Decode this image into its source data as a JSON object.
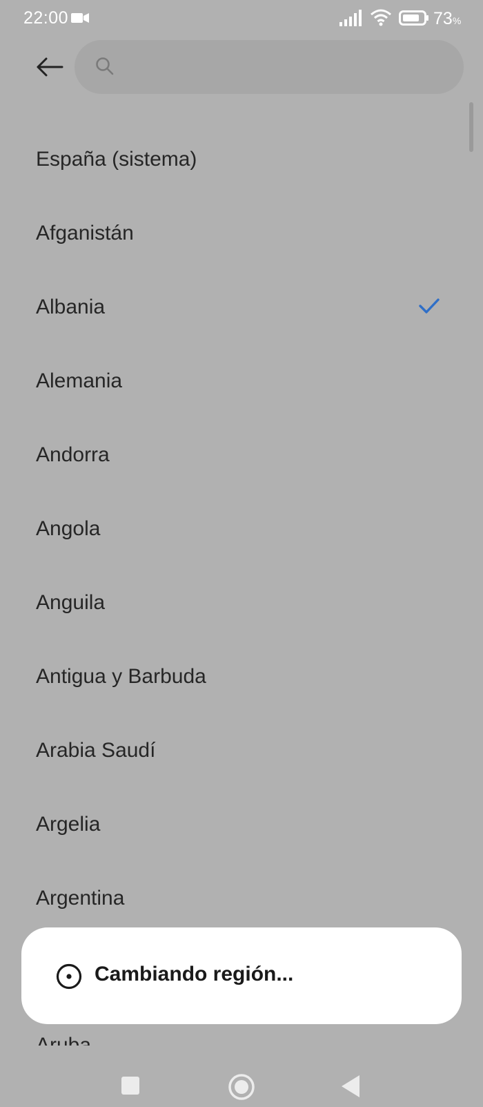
{
  "status_bar": {
    "time": "22:00",
    "battery_percent": "73",
    "battery_unit": "%",
    "icons": [
      "video-camera-icon",
      "signal-icon",
      "wifi-icon",
      "battery-icon"
    ]
  },
  "search": {
    "placeholder": "",
    "value": ""
  },
  "regions": [
    {
      "label": "España (sistema)",
      "selected": false
    },
    {
      "label": "Afganistán",
      "selected": false
    },
    {
      "label": "Albania",
      "selected": true
    },
    {
      "label": "Alemania",
      "selected": false
    },
    {
      "label": "Andorra",
      "selected": false
    },
    {
      "label": "Angola",
      "selected": false
    },
    {
      "label": "Anguila",
      "selected": false
    },
    {
      "label": "Antigua y Barbuda",
      "selected": false
    },
    {
      "label": "Arabia Saudí",
      "selected": false
    },
    {
      "label": "Argelia",
      "selected": false
    },
    {
      "label": "Argentina",
      "selected": false
    }
  ],
  "partial_item": "Aruba",
  "toast": {
    "message": "Cambiando región..."
  },
  "colors": {
    "background": "#b1b1b1",
    "accent_check": "#2f6fc7",
    "toast_bg": "#ffffff"
  }
}
